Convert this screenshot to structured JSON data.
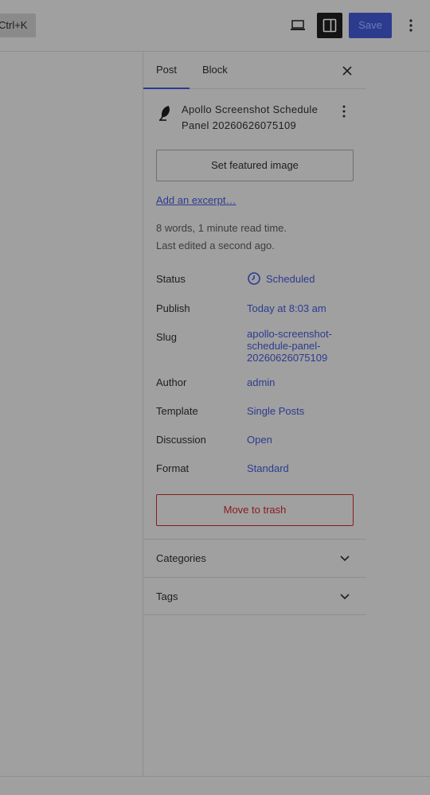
{
  "header": {
    "shortcut_label": "Ctrl+K",
    "save_label": "Save",
    "icons": [
      "laptop-icon",
      "sidebar-toggle-icon",
      "kebab-icon"
    ]
  },
  "sidebar": {
    "tabs": [
      {
        "label": "Post"
      },
      {
        "label": "Block"
      }
    ],
    "post": {
      "title": "Apollo Screenshot Schedule Panel 20260626075109",
      "featured_image_label": "Set featured image",
      "excerpt_link": "Add an excerpt…",
      "stats": "8 words, 1 minute read time.",
      "last_edited": "Last edited a second ago."
    },
    "settings": [
      {
        "label": "Status",
        "value": "Scheduled"
      },
      {
        "label": "Publish",
        "value": "Today at 8:03 am"
      },
      {
        "label": "Slug",
        "value_lines": [
          "apollo-screenshot-",
          "schedule-panel-",
          "20260626075109"
        ]
      },
      {
        "label": "Author",
        "value": "admin"
      },
      {
        "label": "Template",
        "value": "Single Posts"
      },
      {
        "label": "Discussion",
        "value": "Open"
      },
      {
        "label": "Format",
        "value": "Standard"
      }
    ],
    "trash_label": "Move to trash",
    "panels": [
      {
        "label": "Categories"
      },
      {
        "label": "Tags"
      }
    ]
  },
  "colors": {
    "accent": "#2d3b8f",
    "danger": "#8b1a1a",
    "overlay_bg": "#a0a0a0"
  }
}
